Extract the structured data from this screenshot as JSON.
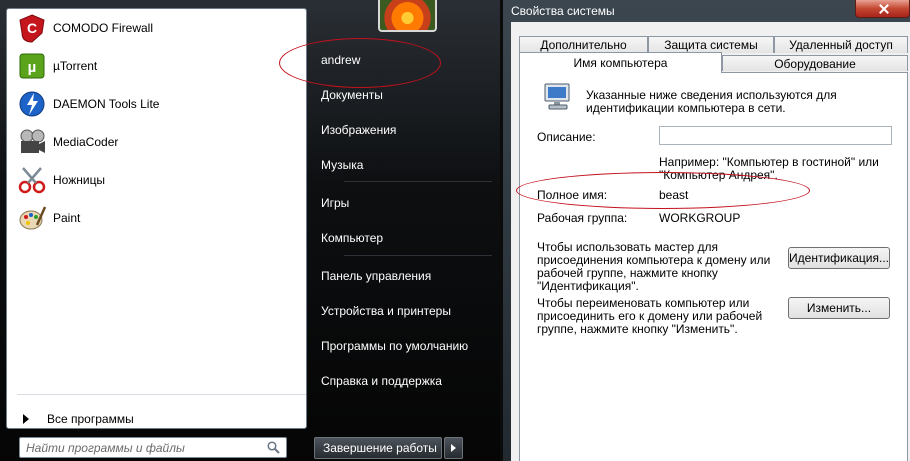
{
  "start_menu": {
    "programs": [
      {
        "label": "COMODO Firewall",
        "icon": "comodo-icon"
      },
      {
        "label": "µTorrent",
        "icon": "utorrent-icon"
      },
      {
        "label": "DAEMON Tools Lite",
        "icon": "daemon-tools-icon"
      },
      {
        "label": "MediaCoder",
        "icon": "mediacoder-icon"
      },
      {
        "label": "Ножницы",
        "icon": "scissors-icon"
      },
      {
        "label": "Paint",
        "icon": "paint-icon"
      }
    ],
    "all_programs_label": "Все программы",
    "search_placeholder": "Найти программы и файлы",
    "user_name": "andrew",
    "right_items": [
      "Документы",
      "Изображения",
      "Музыка",
      "Игры",
      "Компьютер",
      "Панель управления",
      "Устройства и принтеры",
      "Программы по умолчанию",
      "Справка и поддержка"
    ],
    "shutdown_label": "Завершение работы"
  },
  "system_properties": {
    "title": "Свойства системы",
    "tabs": {
      "row1": [
        "Дополнительно",
        "Защита системы",
        "Удаленный доступ"
      ],
      "row2": [
        "Имя компьютера",
        "Оборудование"
      ]
    },
    "intro_line1": "Указанные ниже сведения используются для",
    "intro_line2": "идентификации компьютера в сети.",
    "description_label": "Описание:",
    "description_value": "",
    "example_line1": "Например: \"Компьютер в гостиной\" или",
    "example_line2": "\"Компьютер Андрея\".",
    "full_name_label": "Полное имя:",
    "full_name_value": "beast",
    "workgroup_label": "Рабочая группа:",
    "workgroup_value": "WORKGROUP",
    "wizard_line1": "Чтобы использовать мастер для",
    "wizard_line2": "присоединения компьютера к домену или",
    "wizard_line3": "рабочей группе, нажмите кнопку",
    "wizard_line4": "\"Идентификация\".",
    "identify_button": "Идентификация...",
    "rename_line1": "Чтобы переименовать компьютер или",
    "rename_line2": "присоединить его к домену или рабочей",
    "rename_line3": "группе, нажмите кнопку \"Изменить\".",
    "change_button": "Изменить..."
  },
  "colors": {
    "annotation": "#c4111c",
    "start_menu_bg": "#0b0b0b",
    "dialog_bg": "#f0f0f0"
  }
}
